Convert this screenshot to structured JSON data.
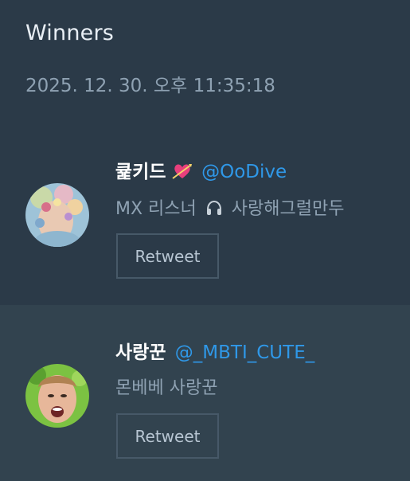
{
  "header": {
    "title": "Winners",
    "timestamp": "2025. 12. 30. 오후 11:35:18"
  },
  "winners": [
    {
      "display_name": "큝키드",
      "name_icon": "heart-with-arrow-icon",
      "handle": "@OoDive",
      "bio_prefix": "MX 리스너",
      "bio_icon": "headphones-icon",
      "bio_suffix": "사랑해그럴만두",
      "button_label": "Retweet"
    },
    {
      "display_name": "사랑꾼",
      "handle": "@_MBTI_CUTE_",
      "bio": "몬베베 사랑꾼",
      "button_label": "Retweet"
    }
  ],
  "colors": {
    "background": "#2b3a48",
    "alt_row_background": "#32434f",
    "handle": "#2f98e8",
    "muted_text": "#8fa2b3"
  }
}
